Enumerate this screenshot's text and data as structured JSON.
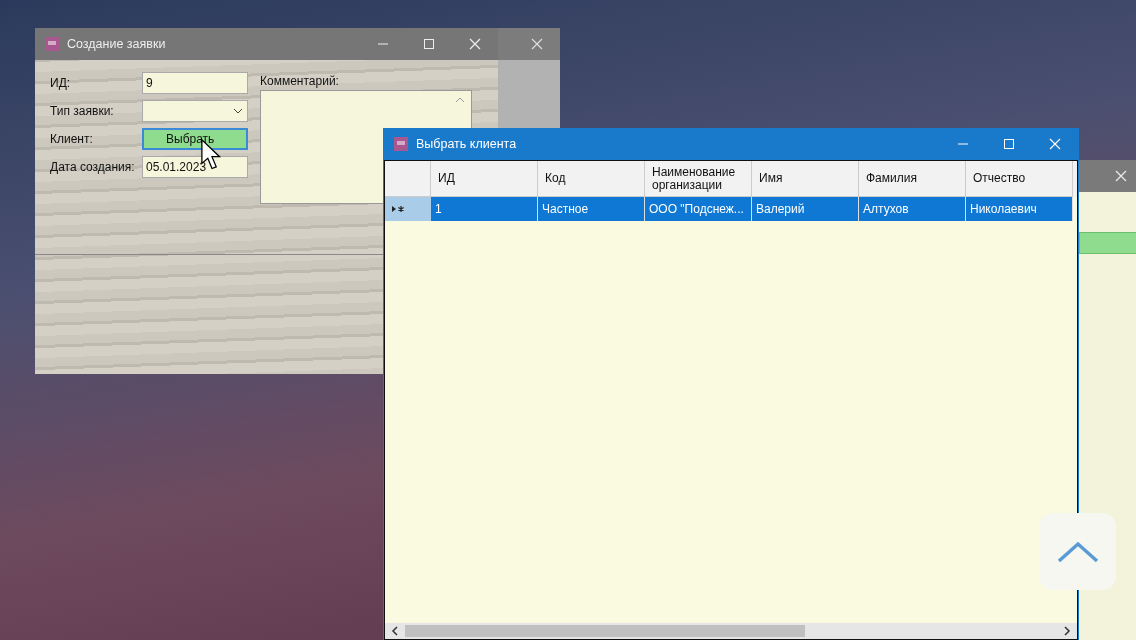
{
  "order_window": {
    "title": "Создание заявки",
    "fields": [
      {
        "label": "ИД:",
        "kind": "text",
        "value": "9"
      },
      {
        "label": "Тип заявки:",
        "kind": "combo"
      },
      {
        "label": "Клиент:",
        "kind": "button",
        "value": "Выбрать"
      },
      {
        "label": "Дата создания:",
        "kind": "text",
        "value": "05.01.2023"
      }
    ],
    "comment_label": "Комментарий:"
  },
  "client_window": {
    "title": "Выбрать клиента",
    "columns": [
      "ИД",
      "Код",
      "Наименование организации",
      "Имя",
      "Фамилия",
      "Отчество"
    ],
    "rows": [
      {
        "selected": true,
        "cells": [
          "1",
          "Частное",
          "ООО \"Подснеж...",
          "Валерий",
          "Алтухов",
          "Николаевич"
        ]
      }
    ]
  }
}
